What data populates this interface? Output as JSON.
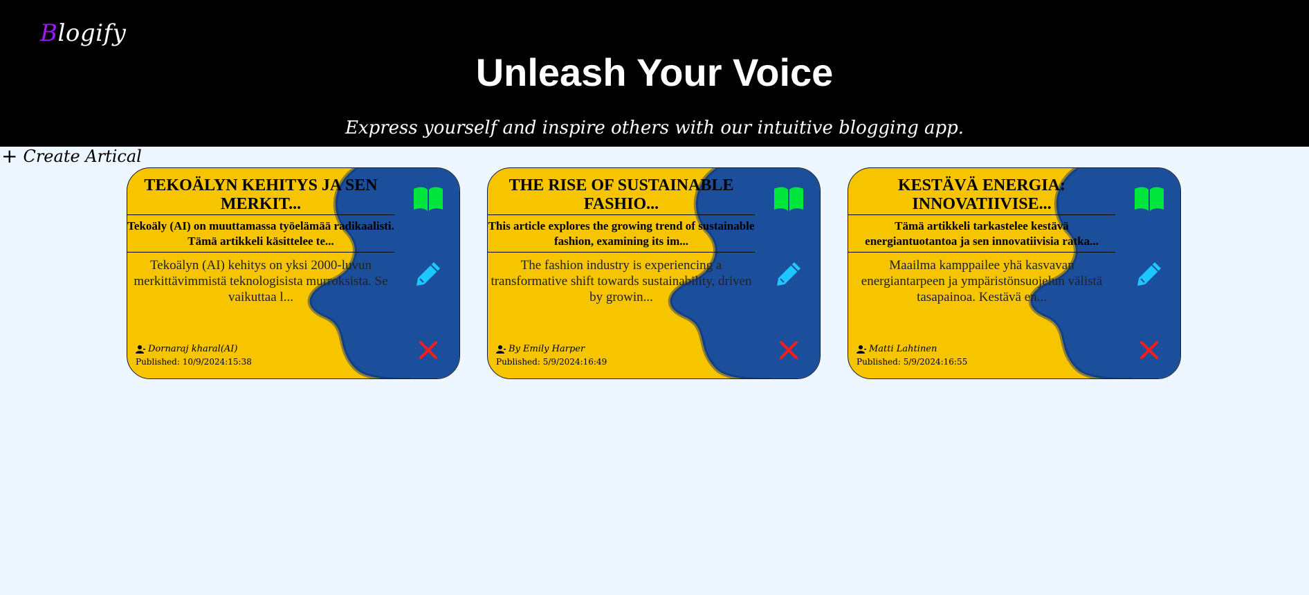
{
  "header": {
    "logo_first": "B",
    "logo_rest": "logify",
    "title": "Unleash Your Voice",
    "subtitle": "Express yourself and inspire others with our intuitive blogging app."
  },
  "actions": {
    "create_label": "Create Artical"
  },
  "colors": {
    "header_bg": "#000000",
    "page_bg": "#eef6ff",
    "logo_accent": "#9b19f5",
    "card_yellow": "#f7c400",
    "card_blue": "#1b4f9c",
    "read_icon": "#00e63c",
    "edit_icon": "#1ec8ff",
    "delete_icon": "#ff1a1a"
  },
  "icons": {
    "create": "plus-icon",
    "read": "book-open-icon",
    "edit": "pencil-icon",
    "delete": "close-icon",
    "author": "user-icon"
  },
  "articles": [
    {
      "title": "TEKOÄLYN KEHITYS JA SEN MERKIT...",
      "summary": "Tekoäly (AI) on muuttamassa työelämää radikaalisti. Tämä artikkeli käsittelee te...",
      "body": "Tekoälyn (AI) kehitys on yksi 2000-luvun merkittävimmistä teknologisista murroksista. Se vaikuttaa l...",
      "author": "Dornaraj kharal(AI)",
      "published": "Published: 10/9/2024:15:38"
    },
    {
      "title": "THE RISE OF SUSTAINABLE FASHIO...",
      "summary": "This article explores the growing trend of sustainable fashion, examining its im...",
      "body": "The fashion industry is experiencing a transformative shift towards sustainability, driven by growin...",
      "author": "By Emily Harper",
      "published": "Published: 5/9/2024:16:49"
    },
    {
      "title": "KESTÄVÄ ENERGIA: INNOVATIIVISE...",
      "summary": "Tämä artikkeli tarkastelee kestävä energiantuotantoa ja sen innovatiivisia ratka...",
      "body": "Maailma kamppailee yhä kasvavan energiantarpeen ja ympäristönsuojelun välistä tasapainoa. Kestävä en...",
      "author": "Matti Lahtinen",
      "published": "Published: 5/9/2024:16:55"
    }
  ]
}
